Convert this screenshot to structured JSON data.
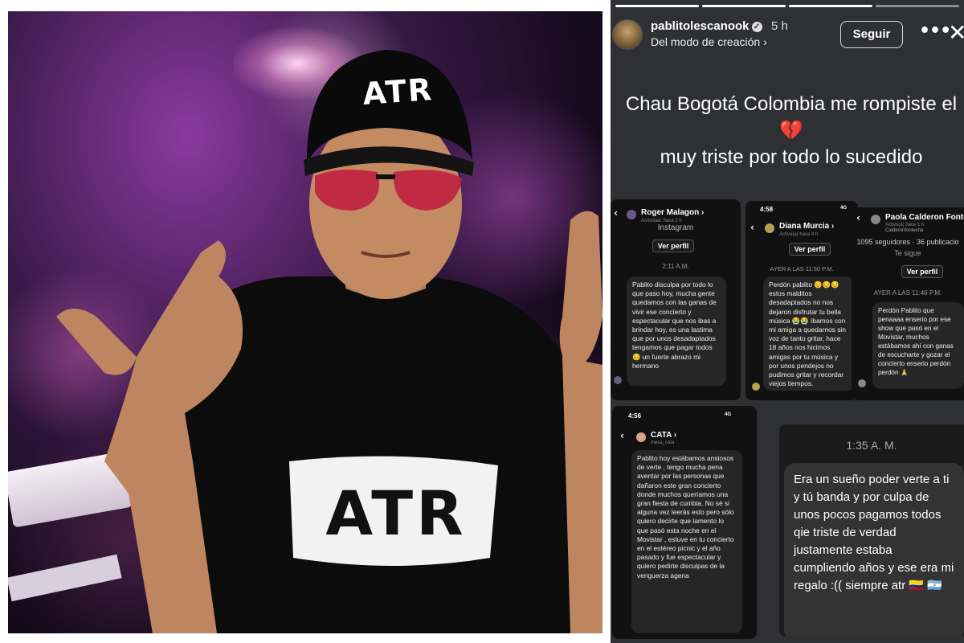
{
  "photo": {
    "cap_text": "ATR",
    "shirt_text": "ATR"
  },
  "story": {
    "username": "pablitolescanook",
    "verified_mark": "✓",
    "time": "5 h",
    "subtitle": "Del modo de creación ›",
    "follow_label": "Seguir",
    "more_icon": "•••",
    "close_icon": "✕",
    "caption_line1": "Chau Bogotá Colombia me rompiste el",
    "caption_heart": "💔",
    "caption_line2": "muy triste por todo lo sucedido"
  },
  "dm1": {
    "name": "Roger Malagon ›",
    "activity": "Actividad: hace 2 h",
    "platform": "Instagram",
    "profile_button": "Ver perfil",
    "timestamp": "2:11 A.M.",
    "message": "Pablito disculpa por todo lo que paso hoy, mucha gente quedamos con las ganas de vivir ese concierto y espectacular que nos ibas a brindar hoy, es una lastima que por unos desadaptados tengamos que pagar todos 😔 un fuerte abrazo mi hermano"
  },
  "dm2": {
    "clock": "4:58",
    "signal": "4G",
    "name": "Diana Murcia ›",
    "activity": "Activo(a) hace 4 h",
    "profile_button": "Ver perfil",
    "timestamp": "AYER A LAS 11:50 P.M.",
    "message": "Perdón pablito 😔😔😔 estos malditos desadaptados no nos dejaron disfrutar tu bella música 😭😭 íbamos con mi amiga a quedarnos sin voz de tanto gritar, hace 18 años nos hicimos amigas por tu música y por unos pendejos no pudimos gritar y recordar viejos tiempos."
  },
  "dm3": {
    "name": "Paola Calderon Fonte",
    "handle": "Calderonfontecha",
    "activity": "Activo(a) hace 1 h",
    "stats": "1095 seguidores · 36 publicacio",
    "follows_you": "Te sigue",
    "profile_button": "Ver perfil",
    "timestamp": "AYER A LAS 11:46 P.M.",
    "message": "Perdón Pablito que penaaaa enserio por ese show que pasó en el Movistar, muchos estábamos ahí con ganas de escucharte y gozar el concierto enserio perdón perdón 🙏"
  },
  "dm4": {
    "clock": "4:56",
    "signal": "4G",
    "name": "CATA ›",
    "handle": "mesa_cata",
    "message": "Pablito hoy estábamos ansiosos de verte , tengo mucha pena aventar por las personas que dañaron este gran concierto donde muchos queríamos una gran fiesta de cumbia. No sé si alguna vez leerás esto pero sólo quiero decirte que lamento lo que pasó esta noche en el Movistar , estuve en tu concierto en el estéreo picnic y el año pasado y fue espectacular y quiero pedirte disculpas de la venguerza agena"
  },
  "dm5": {
    "timestamp": "1:35 A. M.",
    "message": "Era un sueño poder verte a ti y tú banda y por culpa de unos pocos pagamos todos qie triste de verdad justamente estaba cumpliendo años y ese era mi regalo :(( siempre atr 🇨🇴 🇦🇷"
  }
}
